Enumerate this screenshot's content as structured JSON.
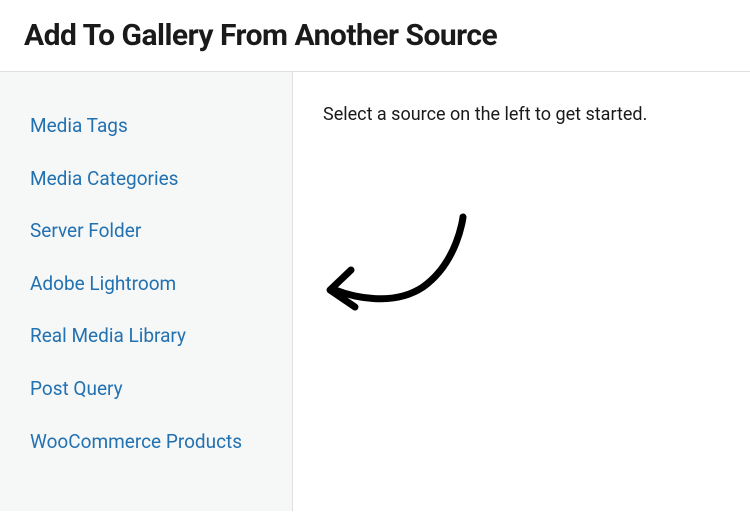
{
  "header": {
    "title": "Add To Gallery From Another Source"
  },
  "sidebar": {
    "items": [
      {
        "label": "Media Tags"
      },
      {
        "label": "Media Categories"
      },
      {
        "label": "Server Folder"
      },
      {
        "label": "Adobe Lightroom"
      },
      {
        "label": "Real Media Library"
      },
      {
        "label": "Post Query"
      },
      {
        "label": "WooCommerce Products"
      }
    ]
  },
  "main": {
    "instruction": "Select a source on the left to get started."
  }
}
